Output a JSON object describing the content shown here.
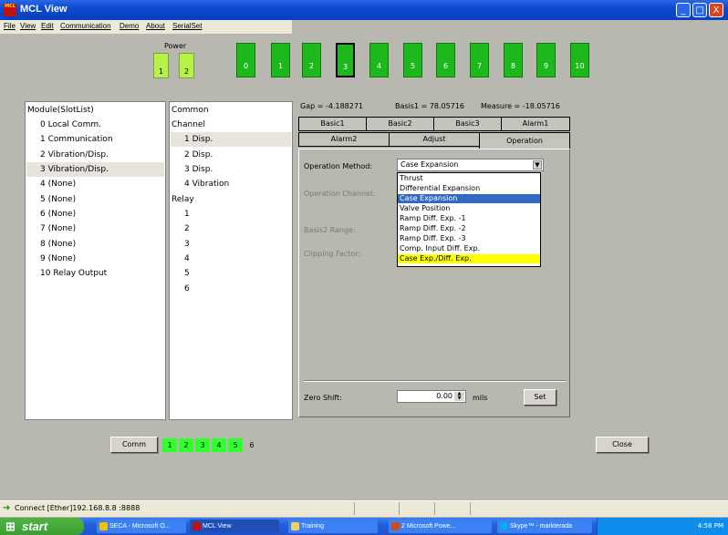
{
  "window": {
    "title": "MCL View",
    "app_icon_text": "MCL"
  },
  "titlebar_buttons": {
    "minimize": "_",
    "maximize": "□",
    "close": "X"
  },
  "menu": [
    "File",
    "View",
    "Edit",
    "Communication",
    "Demo",
    "About",
    "SerialSet"
  ],
  "power": {
    "label": "Power",
    "buttons": [
      "1",
      "2"
    ]
  },
  "slots": [
    "0",
    "1",
    "2",
    "3",
    "4",
    "5",
    "6",
    "7",
    "8",
    "9",
    "10"
  ],
  "module_list": {
    "header": "Module(SlotList)",
    "items": [
      "0 Local Comm.",
      "1 Communication",
      "2 Vibration/Disp.",
      "3 Vibration/Disp.",
      "4 (None)",
      "5 (None)",
      "6 (None)",
      "7 (None)",
      "8 (None)",
      "9 (None)",
      "10 Relay Output"
    ]
  },
  "channel_list": {
    "items": [
      "Common",
      "Channel",
      "1 Disp.",
      "2 Disp.",
      "3 Disp.",
      "4 Vibration",
      "Relay",
      "1",
      "2",
      "3",
      "4",
      "5",
      "6"
    ]
  },
  "readouts": {
    "gap": "Gap = -4.188271",
    "basis1": "Basis1 = 78.05716",
    "measure": "Measure = -18.05716"
  },
  "tabs_row1": [
    "Basic1",
    "Basic2",
    "Basic3",
    "Alarm1"
  ],
  "tabs_row2": [
    "Alarm2",
    "Adjust",
    "Operation"
  ],
  "operation": {
    "method_label": "Operation Method:",
    "method_value": "Case Expansion",
    "channel_label": "Operation Channel:",
    "basis2_label": "Basis2 Range:",
    "clipping_label": "Clipping Factor:",
    "options": [
      "Thrust",
      "Differential Expansion",
      "Case Expansion",
      "Valve Position",
      "Ramp Diff. Exp. -1",
      "Ramp Diff. Exp. -2",
      "Ramp Diff. Exp. -3",
      "Comp. Input Diff. Exp.",
      "Case Exp./Diff. Exp."
    ],
    "zero_shift_label": "Zero Shift:",
    "zero_shift_value": "0.00",
    "zero_shift_unit": "mils",
    "set_label": "Set"
  },
  "bottom": {
    "comm_label": "Comm",
    "comm_slots": [
      "1",
      "2",
      "3",
      "4",
      "5",
      "6"
    ],
    "close_label": "Close"
  },
  "status": {
    "connect": "Connect [Ether]192.168.8.8 :8888"
  },
  "taskbar": {
    "start": "start",
    "tasks": [
      "SECA - Microsoft O...",
      "MCL View",
      "Training",
      "2 Microsoft Powe...",
      "Skype™ - markterada"
    ],
    "clock": "4:58 PM"
  },
  "colors": {
    "slot_green": "#1cb81c",
    "power_green": "#b6f24a",
    "highlight": "#316ac5",
    "yellow": "#ffff00"
  }
}
